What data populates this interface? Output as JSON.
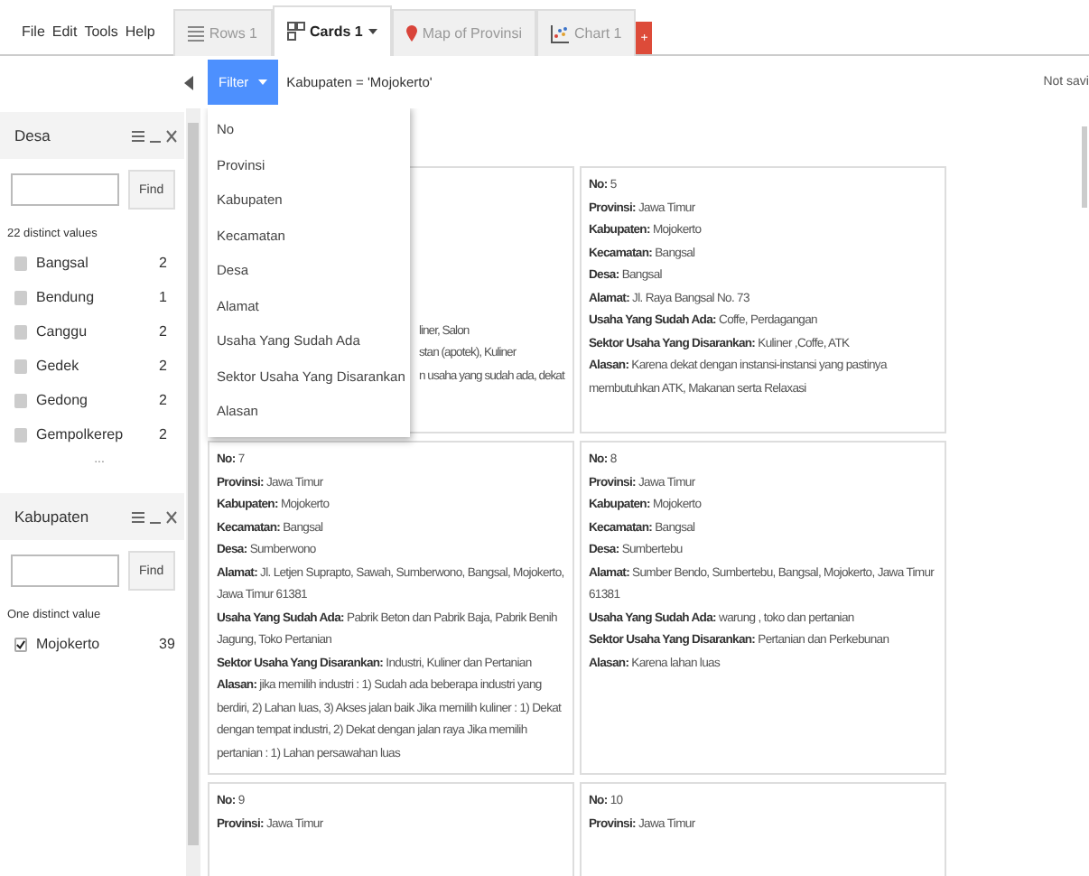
{
  "menu": [
    "File",
    "Edit",
    "Tools",
    "Help"
  ],
  "tabs": [
    {
      "label": "Rows 1",
      "kind": "rows",
      "selected": false
    },
    {
      "label": "Cards 1",
      "kind": "cards",
      "selected": true
    },
    {
      "label": "Map of Provinsi",
      "kind": "map",
      "selected": false
    },
    {
      "label": "Chart 1",
      "kind": "chart",
      "selected": false
    }
  ],
  "add_tab": "+",
  "filter": {
    "button": "Filter",
    "expression": "Kabupaten = 'Mojokerto'",
    "status": "Not savi"
  },
  "filter_menu": [
    "No",
    "Provinsi",
    "Kabupaten",
    "Kecamatan",
    "Desa",
    "Alamat",
    "Usaha Yang Sudah Ada",
    "Sektor Usaha Yang Disarankan",
    "Alasan"
  ],
  "facets": [
    {
      "title": "Desa",
      "find": "Find",
      "summary": "22 distinct values",
      "more": "...",
      "items": [
        {
          "label": "Bangsal",
          "count": "2",
          "checked": false
        },
        {
          "label": "Bendung",
          "count": "1",
          "checked": false
        },
        {
          "label": "Canggu",
          "count": "2",
          "checked": false
        },
        {
          "label": "Gedek",
          "count": "2",
          "checked": false
        },
        {
          "label": "Gedong",
          "count": "2",
          "checked": false
        },
        {
          "label": "Gempolkerep",
          "count": "2",
          "checked": false
        }
      ]
    },
    {
      "title": "Kabupaten",
      "find": "Find",
      "summary": "One distinct value",
      "items": [
        {
          "label": "Mojokerto",
          "count": "39",
          "checked": true
        }
      ]
    }
  ],
  "cards": [
    {
      "fragments": [
        "liner, Salon",
        "stan (apotek), Kuliner",
        "n usaha yang sudah ada, dekat"
      ]
    },
    {
      "fields": [
        {
          "label": "No:",
          "value": "5"
        },
        {
          "label": "Provinsi:",
          "value": "Jawa Timur"
        },
        {
          "label": "Kabupaten:",
          "value": "Mojokerto"
        },
        {
          "label": "Kecamatan:",
          "value": "Bangsal"
        },
        {
          "label": "Desa:",
          "value": "Bangsal"
        },
        {
          "label": "Alamat:",
          "value": "Jl. Raya Bangsal No. 73"
        },
        {
          "label": "Usaha Yang Sudah Ada:",
          "value": "Coffe, Perdagangan"
        },
        {
          "label": "Sektor Usaha Yang Disarankan:",
          "value": "Kuliner ,Coffe, ATK"
        },
        {
          "label": "Alasan:",
          "value": "Karena dekat dengan instansi-instansi yang pastinya membutuhkan ATK, Makanan serta Relaxasi"
        }
      ]
    },
    {
      "fields": [
        {
          "label": "No:",
          "value": "7"
        },
        {
          "label": "Provinsi:",
          "value": "Jawa Timur"
        },
        {
          "label": "Kabupaten:",
          "value": "Mojokerto"
        },
        {
          "label": "Kecamatan:",
          "value": "Bangsal"
        },
        {
          "label": "Desa:",
          "value": "Sumberwono"
        },
        {
          "label": "Alamat:",
          "value": "Jl. Letjen Suprapto, Sawah, Sumberwono, Bangsal, Mojokerto, Jawa Timur 61381"
        },
        {
          "label": "Usaha Yang Sudah Ada:",
          "value": "Pabrik Beton dan Pabrik Baja, Pabrik Benih Jagung, Toko Pertanian"
        },
        {
          "label": "Sektor Usaha Yang Disarankan:",
          "value": "Industri, Kuliner dan Pertanian"
        },
        {
          "label": "Alasan:",
          "value": "jika memilih industri : 1) Sudah ada beberapa industri yang berdiri, 2) Lahan luas, 3) Akses jalan baik Jika memilih kuliner : 1) Dekat dengan tempat industri, 2) Dekat dengan jalan raya Jika memilih pertanian : 1) Lahan persawahan luas"
        }
      ]
    },
    {
      "fields": [
        {
          "label": "No:",
          "value": "8"
        },
        {
          "label": "Provinsi:",
          "value": "Jawa Timur"
        },
        {
          "label": "Kabupaten:",
          "value": "Mojokerto"
        },
        {
          "label": "Kecamatan:",
          "value": "Bangsal"
        },
        {
          "label": "Desa:",
          "value": "Sumbertebu"
        },
        {
          "label": "Alamat:",
          "value": "Sumber Bendo, Sumbertebu, Bangsal, Mojokerto, Jawa Timur 61381"
        },
        {
          "label": "Usaha Yang Sudah Ada:",
          "value": "warung , toko dan pertanian"
        },
        {
          "label": "Sektor Usaha Yang Disarankan:",
          "value": "Pertanian dan Perkebunan"
        },
        {
          "label": "Alasan:",
          "value": "Karena lahan luas"
        }
      ]
    },
    {
      "fields": [
        {
          "label": "No:",
          "value": "9"
        },
        {
          "label": "Provinsi:",
          "value": "Jawa Timur"
        }
      ]
    },
    {
      "fields": [
        {
          "label": "No:",
          "value": "10"
        },
        {
          "label": "Provinsi:",
          "value": "Jawa Timur"
        }
      ]
    }
  ]
}
